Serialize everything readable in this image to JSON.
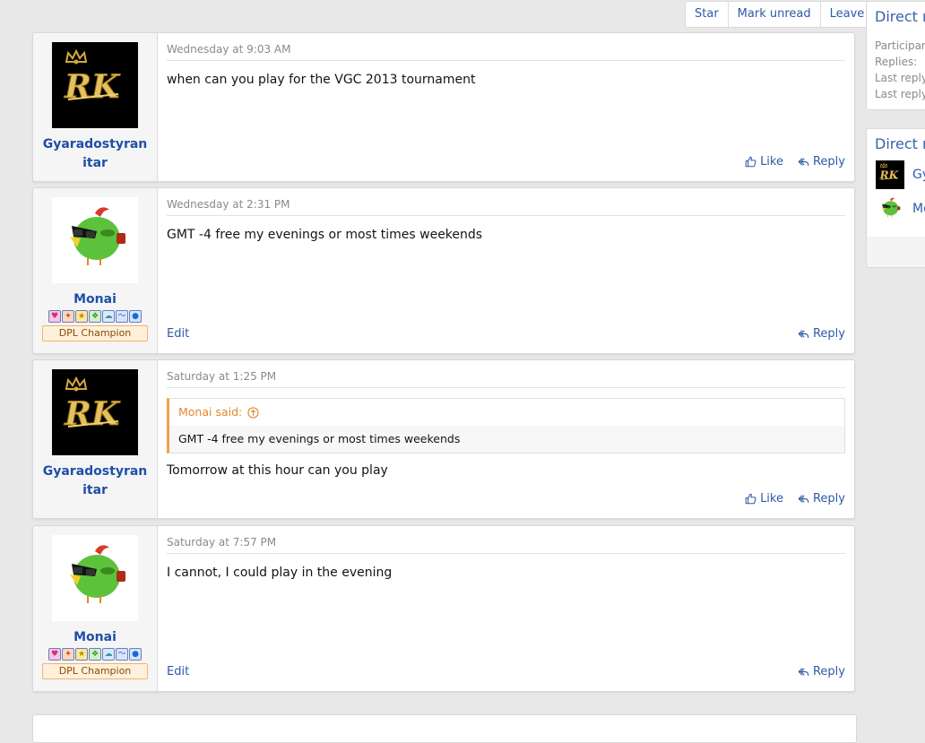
{
  "top_actions": {
    "star": "Star",
    "mark_unread": "Mark unread",
    "leave": "Leave"
  },
  "messages": [
    {
      "user": "Gyaradostyranitar",
      "time": "Wednesday at 9:03 AM",
      "text": "when can you play for the VGC 2013 tournament",
      "like": "Like",
      "reply": "Reply"
    },
    {
      "user": "Monai",
      "time": "Wednesday at 2:31 PM",
      "text": "GMT -4 free my evenings or most times weekends",
      "title": "DPL Champion",
      "edit": "Edit",
      "reply": "Reply"
    },
    {
      "user": "Gyaradostyranitar",
      "time": "Saturday at 1:25 PM",
      "quote_author": "Monai said:",
      "quote_text": "GMT -4 free my evenings or most times weekends",
      "text": "Tomorrow at this hour can you play",
      "like": "Like",
      "reply": "Reply"
    },
    {
      "user": "Monai",
      "time": "Saturday at 7:57 PM",
      "text": "I cannot, I could play in the evening",
      "title": "DPL Champion",
      "edit": "Edit",
      "reply": "Reply"
    }
  ],
  "sidebar": {
    "info_title": "Direct m",
    "participants_label": "Participan",
    "replies_label": "Replies:",
    "last_reply_label_1": "Last reply",
    "last_reply_label_2": "Last reply",
    "participants_title": "Direct m",
    "participant_1": "Gy",
    "participant_2": "Mo"
  },
  "colors": {
    "link": "#2d5aa8",
    "username": "#1f4fa8",
    "quote_accent": "#f0a04b",
    "title_banner_bg": "#fff0dc"
  }
}
